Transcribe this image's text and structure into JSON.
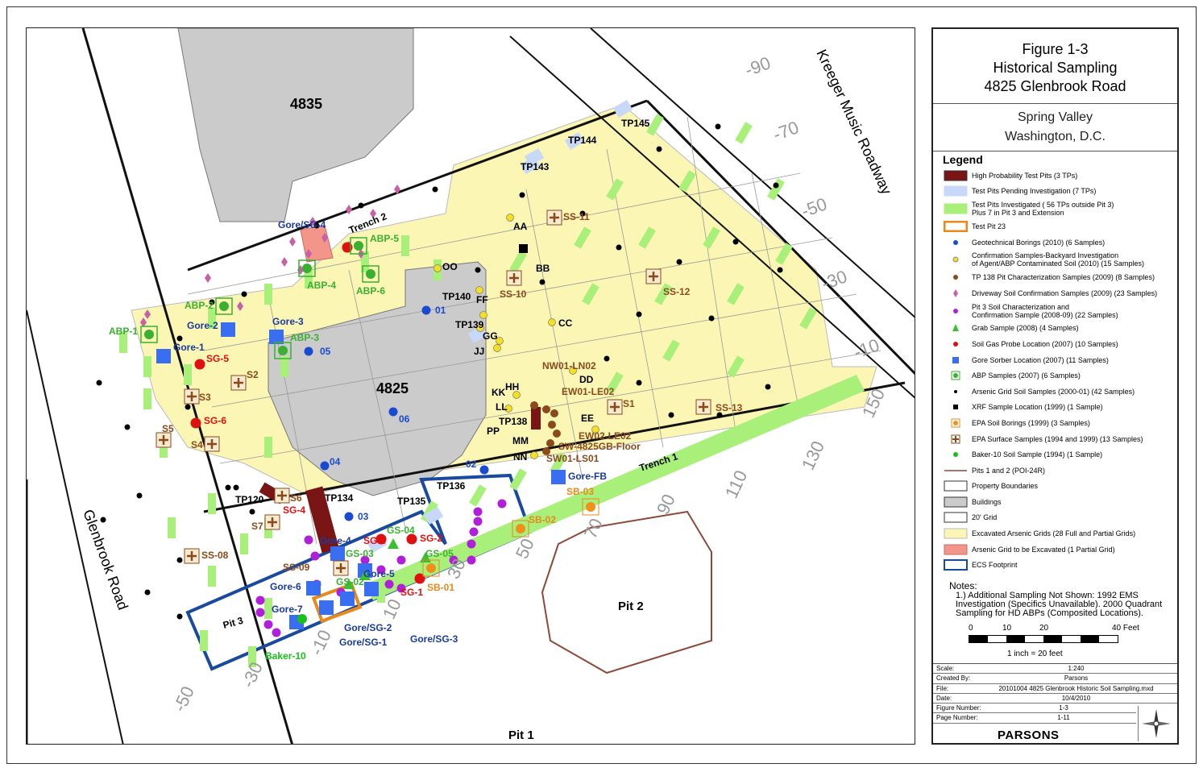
{
  "title": {
    "line1": "Figure 1-3",
    "line2": "Historical Sampling",
    "line3": "4825 Glenbrook Road"
  },
  "subtitle": {
    "line1": "Spring Valley",
    "line2": "Washington, D.C."
  },
  "legend": {
    "heading": "Legend",
    "items": [
      {
        "label": "High Probability Test Pits (3 TPs)",
        "symbol": "darkred-rect"
      },
      {
        "label": "Test Pits Pending Investigation (7 TPs)",
        "symbol": "lightblue-rect"
      },
      {
        "label": "Test Pits Investigated ( 56 TPs outside Pit 3)\nPlus 7 in Pit 3 and Extension",
        "symbol": "green-rect"
      },
      {
        "label": "Test Pit 23",
        "symbol": "orange-outline-rect"
      },
      {
        "label": "Geotechnical Borings (2010) (6 Samples)",
        "symbol": "blue-dot"
      },
      {
        "label": "Confirmation Samples-Backyard Investigation\nof Agent/ABP Contaminated Soil (2010) (15 Samples)",
        "symbol": "yellow-dot"
      },
      {
        "label": "TP 138 Pit Characterization Samples (2009) (8 Samples)",
        "symbol": "brown-dot"
      },
      {
        "label": "Driveway Soil Confirmation Samples (2009) (23 Samples)",
        "symbol": "pink-diamond"
      },
      {
        "label": "Pit 3 Soil Characterization and\nConfirmation Sample (2008-09) (22 Samples)",
        "symbol": "purple-dot"
      },
      {
        "label": "Grab Sample (2008) (4 Samples)",
        "symbol": "green-triangle"
      },
      {
        "label": "Soil Gas Probe Location (2007) (10 Samples)",
        "symbol": "red-dot"
      },
      {
        "label": "Gore Sorber Location (2007) (11 Samples)",
        "symbol": "blue-square"
      },
      {
        "label": "ABP Samples (2007) (6 Samples)",
        "symbol": "green-boxed-dot"
      },
      {
        "label": "Arsenic Grid Soil Samples (2000-01) (42 Samples)",
        "symbol": "black-dot"
      },
      {
        "label": "XRF Sample Location (1999) (1 Sample)",
        "symbol": "black-square"
      },
      {
        "label": "EPA Soil Borings (1999) (3 Samples)",
        "symbol": "orange-boxed-dot"
      },
      {
        "label": "EPA Surface Samples (1994 and 1999) (13 Samples)",
        "symbol": "brown-boxed-cross"
      },
      {
        "label": "Baker-10 Soil Sample (1994) (1 Sample)",
        "symbol": "green-dot"
      },
      {
        "label": "Pits 1 and 2 (POI-24R)",
        "symbol": "brown-line"
      },
      {
        "label": "Property Boundaries",
        "symbol": "white-rect"
      },
      {
        "label": "Buildings",
        "symbol": "grey-rect"
      },
      {
        "label": "20' Grid",
        "symbol": "white-rect"
      },
      {
        "label": "Excavated Arsenic Grids (28 Full and Partial Grids)",
        "symbol": "yellow-rect"
      },
      {
        "label": "Arsenic Grid to be Excavated (1 Partial Grid)",
        "symbol": "salmon-rect"
      },
      {
        "label": "ECS Footprint",
        "symbol": "blue-outline-rect"
      }
    ]
  },
  "notes": {
    "heading": "Notes:",
    "text": "1.)  Additional Sampling Not Shown: 1992 EMS Investigation (Specifics Unavailable). 2000 Quadrant Sampling for HD ABPs (Composited Locations)."
  },
  "scale_bar": {
    "ticks": [
      "0",
      "10",
      "20",
      "40 Feet"
    ],
    "caption": "1 inch = 20 feet"
  },
  "meta": {
    "rows": [
      {
        "key": "Scale:",
        "value": "1:240"
      },
      {
        "key": "Created By:",
        "value": "Parsons"
      },
      {
        "key": "File:",
        "value": "20101004 4825 Glenbrook Historic Soil Sampling.mxd"
      },
      {
        "key": "Date:",
        "value": "10/4/2010"
      },
      {
        "key": "Figure Number:",
        "value": "1-3"
      },
      {
        "key": "Page Number:",
        "value": "1-11"
      }
    ]
  },
  "brand": "PARSONS",
  "map": {
    "buildings": [
      "4835",
      "4825"
    ],
    "roads": [
      "Kreeger Music Roadway",
      "Glenbrook Road"
    ],
    "pits": [
      "Pit 1",
      "Pit 2",
      "Pit 3"
    ],
    "trenches": [
      "Trench 1",
      "Trench 2"
    ],
    "contours": [
      "-90",
      "-70",
      "-50",
      "-30",
      "-10",
      "150",
      "130",
      "110",
      "90",
      "70",
      "50",
      "30",
      "10",
      "-10",
      "-30",
      "-50"
    ],
    "sample_labels": [
      "TP145",
      "TP144",
      "TP143",
      "SS-11",
      "SS-12",
      "SS-13",
      "SS-10",
      "SS-08",
      "SS-09",
      "S1",
      "S2",
      "S3",
      "S4",
      "S5",
      "S6",
      "S7",
      "AA",
      "BB",
      "CC",
      "DD",
      "EE",
      "FF",
      "GG",
      "HH",
      "JJ",
      "KK",
      "LL",
      "MM",
      "NN",
      "OO",
      "PP",
      "TP140",
      "TP139",
      "TP138",
      "TP136",
      "TP135",
      "TP134",
      "TP120",
      "NW01-LN02",
      "EW01-LE02",
      "EW02-LE02",
      "SW-4825GB-Floor",
      "SW01-LS01",
      "01",
      "02",
      "03",
      "04",
      "05",
      "06",
      "ABP-1",
      "ABP-2",
      "ABP-3",
      "ABP-4",
      "ABP-5",
      "ABP-6",
      "Gore-1",
      "Gore-2",
      "Gore-3",
      "Gore-4",
      "Gore-5",
      "Gore-6",
      "Gore-7",
      "Gore-FB",
      "Gore/SG-1",
      "Gore/SG-2",
      "Gore/SG-3",
      "Gore/SG-4",
      "SG-1",
      "SG-2",
      "SG-3",
      "SG-4",
      "SG-5",
      "SG-6",
      "GS-02",
      "GS-03",
      "GS-04",
      "GS-05",
      "SB-01",
      "SB-02",
      "SB-03",
      "Baker-10"
    ]
  },
  "colors": {
    "excavated": "#fbf6b4",
    "test_pit": "#a8f07a",
    "pending": "#c8d8f8",
    "building": "#cbcbcb",
    "ecs": "#1a4aa0",
    "pit_line": "#8b4a3a",
    "soil_gas": "#e01010",
    "gore": "#3a6ef0",
    "purple": "#b020d8",
    "abp": "#3ab030",
    "brown": "#8b4a1a"
  }
}
